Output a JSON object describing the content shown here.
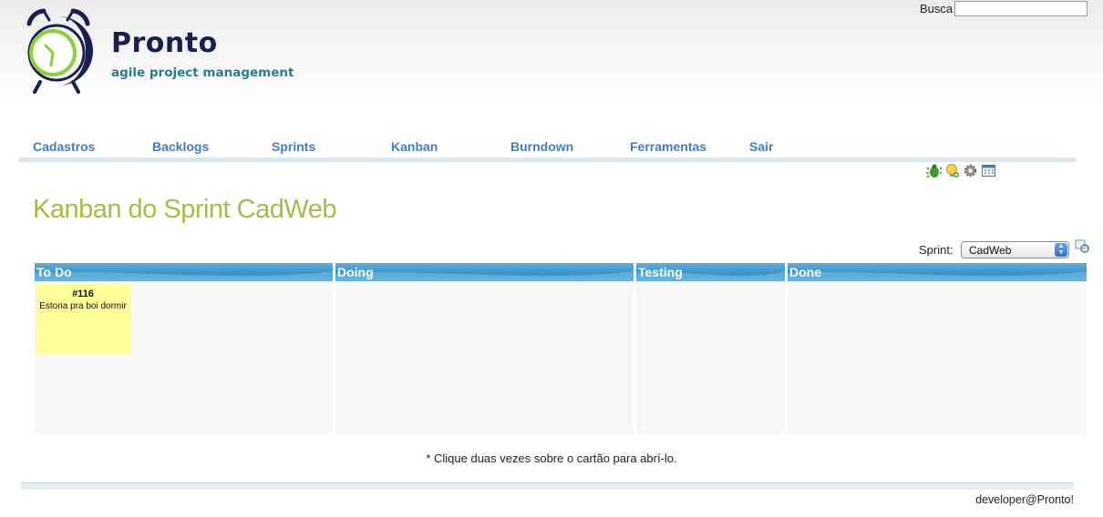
{
  "header": {
    "title": "Pronto",
    "subtitle": "agile project management",
    "search_label": "Busca",
    "search_value": ""
  },
  "nav": {
    "items": [
      {
        "label": "Cadastros"
      },
      {
        "label": "Backlogs"
      },
      {
        "label": "Sprints"
      },
      {
        "label": "Kanban"
      },
      {
        "label": "Burndown"
      },
      {
        "label": "Ferramentas"
      },
      {
        "label": "Sair"
      }
    ]
  },
  "toolbar": {
    "icons": [
      "bug-icon",
      "idea-icon",
      "gear-icon",
      "calendar-icon"
    ]
  },
  "page": {
    "title": "Kanban do Sprint CadWeb",
    "sprint_label": "Sprint:",
    "sprint_selected": "CadWeb"
  },
  "board": {
    "columns": [
      {
        "title": "To Do"
      },
      {
        "title": "Doing"
      },
      {
        "title": "Testing"
      },
      {
        "title": "Done"
      }
    ],
    "cards": [
      {
        "id": "#116",
        "text": "Estoria pra boi dormir",
        "column": "To Do"
      }
    ]
  },
  "hint": "* Clique duas vezes sobre o cartão para abrí-lo.",
  "footer": {
    "user": "developer@Pronto!"
  },
  "colors": {
    "title_green": "#a5bd48",
    "nav_blue": "#3d7ec2",
    "logo_navy": "#1a1f4f",
    "column_header": "#3a93c6",
    "card_yellow": "#ffff99"
  }
}
